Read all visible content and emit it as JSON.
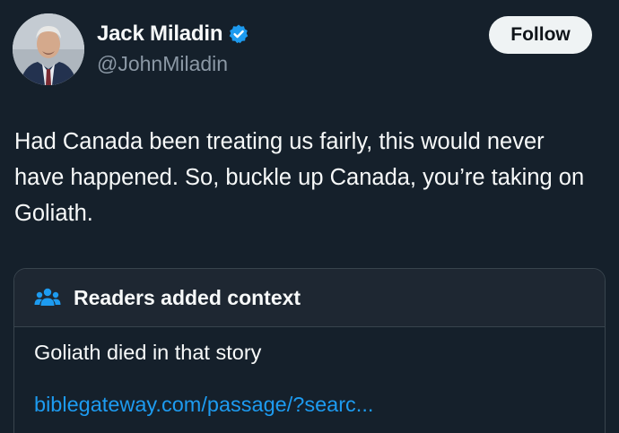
{
  "author": {
    "display_name": "Jack Miladin",
    "handle": "@JohnMiladin",
    "avatar": "profile-photo",
    "verified_icon": "verified-badge-icon"
  },
  "follow_label": "Follow",
  "tweet": {
    "text": "Had Canada been treating us fairly, this would never have happened. So, buckle up Canada, you’re taking on Goliath."
  },
  "community_note": {
    "icon": "people-icon",
    "title": "Readers added context",
    "note": "Goliath died in that story",
    "link": "biblegateway.com/passage/?searc..."
  },
  "colors": {
    "background": "#15202b",
    "accent": "#1d9bf0",
    "secondary_text": "#8b98a5"
  }
}
